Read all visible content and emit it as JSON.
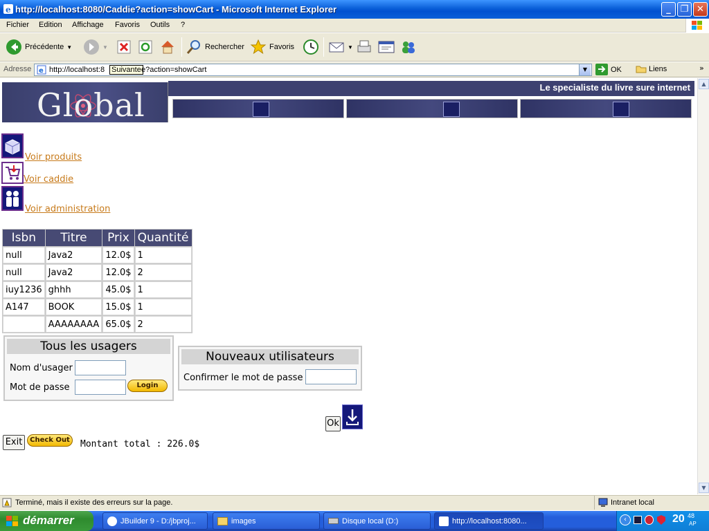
{
  "window": {
    "title": "http://localhost:8080/Caddie?action=showCart - Microsoft Internet Explorer",
    "controls": [
      "minimize",
      "maximize",
      "close"
    ]
  },
  "menu": [
    "Fichier",
    "Edition",
    "Affichage",
    "Favoris",
    "Outils",
    "?"
  ],
  "toolbar": {
    "back_label": "Précédente",
    "search_label": "Rechercher",
    "favorites_label": "Favoris"
  },
  "address": {
    "label": "Adresse",
    "url_start": "http://localhost:8",
    "url_end": "e?action=showCart",
    "tooltip": "Suivante",
    "go_label": "OK",
    "links_label": "Liens"
  },
  "page": {
    "logo": "Global",
    "slogan": "Le specialiste du livre sure internet",
    "links": {
      "products": "Voir produits",
      "cart": "Voir caddie",
      "admin": "Voir administration"
    },
    "cart_table": {
      "headers": [
        "Isbn",
        "Titre",
        "Prix",
        "Quantité"
      ],
      "rows": [
        [
          "null",
          "Java2",
          "12.0$",
          "1"
        ],
        [
          "null",
          "Java2",
          "12.0$",
          "2"
        ],
        [
          "iuy1236",
          "ghhh",
          "45.0$",
          "1"
        ],
        [
          "A147",
          "BOOK",
          "15.0$",
          "1"
        ],
        [
          "",
          "AAAAAAAA",
          "65.0$",
          "2"
        ]
      ]
    },
    "login_panel": {
      "title": "Tous les usagers",
      "username_label": "Nom d'usager",
      "password_label": "Mot de passe",
      "login_button": "Login"
    },
    "new_user_panel": {
      "title": "Nouveaux utilisateurs",
      "confirm_label": "Confirmer le mot de passe"
    },
    "ok_button": "Ok",
    "exit_button": "Exit",
    "checkout_button": "Check Out",
    "total": "Montant total : 226.0$"
  },
  "status": {
    "message": "Terminé, mais il existe des erreurs sur la page.",
    "zone": "Intranet local"
  },
  "taskbar": {
    "start_label": "démarrer",
    "tasks": [
      "JBuilder 9 - D:/jbproj...",
      "images",
      "Disque local (D:)",
      "http://localhost:8080..."
    ],
    "clock": "20",
    "clock_minutes": "48",
    "clock_ampm": "AP"
  },
  "colors": {
    "banner": "#3d4170",
    "link": "#c77a1a",
    "table_header": "#474a74",
    "xp_blue": "#245edb"
  }
}
